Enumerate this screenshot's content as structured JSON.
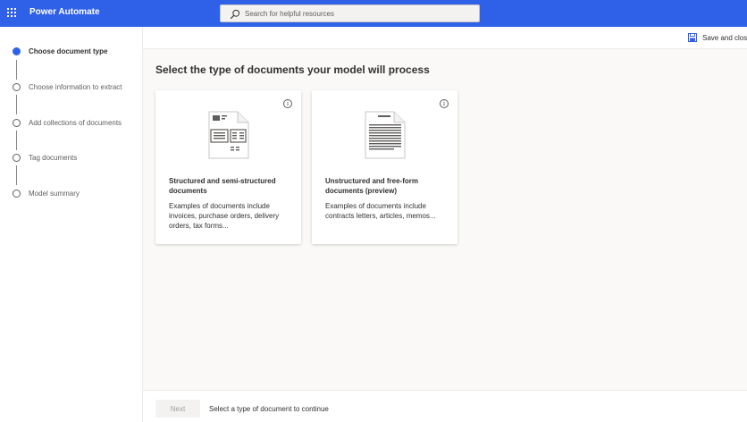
{
  "header": {
    "app_title": "Power Automate",
    "search_placeholder": "Search for helpful resources",
    "accent_color": "#2f60e8"
  },
  "stepper": {
    "steps": [
      {
        "label": "Choose document type",
        "state": "active"
      },
      {
        "label": "Choose information to extract",
        "state": "pending"
      },
      {
        "label": "Add collections of documents",
        "state": "pending"
      },
      {
        "label": "Tag documents",
        "state": "pending"
      },
      {
        "label": "Model summary",
        "state": "pending"
      }
    ]
  },
  "command_bar": {
    "save_label": "Save and clos",
    "save_icon": "floppy-disk-icon"
  },
  "main": {
    "heading": "Select the type of documents your model will process",
    "cards": [
      {
        "title": "Structured and semi-structured documents",
        "description": "Examples of documents include invoices, purchase orders, delivery orders, tax forms...",
        "icon": "structured-document-icon",
        "info_icon": "info-icon"
      },
      {
        "title": "Unstructured and free-form documents (preview)",
        "description": "Examples of documents include contracts letters, articles, memos...",
        "icon": "unstructured-document-icon",
        "info_icon": "info-icon"
      }
    ]
  },
  "footer": {
    "next_label": "Next",
    "next_enabled": false,
    "hint": "Select a type of document to continue"
  }
}
